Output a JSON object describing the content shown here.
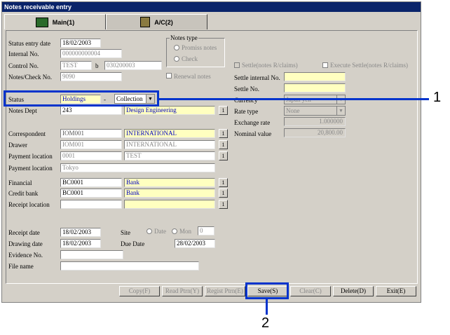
{
  "window": {
    "title": "Notes receivable entry"
  },
  "tabs": [
    {
      "label": "Main(1)"
    },
    {
      "label": "A/C(2)"
    }
  ],
  "form": {
    "status_entry_date": {
      "label": "Status entry date",
      "value": "18/02/2003"
    },
    "internal_no": {
      "label": "Internal No.",
      "value": "000000000004"
    },
    "control_no": {
      "label": "Control No.",
      "prefix": "TEST",
      "sep": "b",
      "value": "030200003"
    },
    "notes_check_no": {
      "label": "Notes/Check No.",
      "value": "9090"
    },
    "notes_type": {
      "label": "Notes type",
      "options": [
        "Promiss notes",
        "Check"
      ]
    },
    "renewal_notes": {
      "label": "Renewal notes"
    },
    "status": {
      "label": "Status",
      "value": "Holdings",
      "dash": "-",
      "select": "Collection"
    },
    "notes_dept": {
      "label": "Notes Dept",
      "code": "243",
      "name": "Design Engineering"
    },
    "correspondent": {
      "label": "Correspondent",
      "code": "IOM001",
      "name": "INTERNATIONAL"
    },
    "drawer": {
      "label": "Drawer",
      "code": "IOM001",
      "name": "INTERNATIONAL"
    },
    "payment_location": {
      "label": "Payment location",
      "code": "0001",
      "name": "TEST"
    },
    "payment_location2": {
      "label": "Payment location",
      "value": "Tokyo"
    },
    "financial": {
      "label": "Financial",
      "code": "BC0001",
      "name": "Bank"
    },
    "credit_bank": {
      "label": "Credit bank",
      "code": "BC0001",
      "name": "Bank"
    },
    "receipt_location": {
      "label": "Receipt location"
    },
    "receipt_date": {
      "label": "Receipt date",
      "value": "18/02/2003"
    },
    "site": {
      "label": "Site",
      "opt1": "Date",
      "opt2": "Mon",
      "value": "0"
    },
    "drawing_date": {
      "label": "Drawing date",
      "value": "18/02/2003"
    },
    "due_date": {
      "label": "Due Date",
      "value": "28/02/2003"
    },
    "evidence_no": {
      "label": "Evidence No."
    },
    "file_name": {
      "label": "File name"
    },
    "settle_chk": {
      "label": "Settle(notes R/claims)"
    },
    "exec_settle_chk": {
      "label": "Execute Settle(notes R/claims)"
    },
    "settle_internal_no": {
      "label": "Settle internal No."
    },
    "settle_no": {
      "label": "Settle No."
    },
    "currency": {
      "label": "Currency",
      "value": "Japan yen"
    },
    "rate_type": {
      "label": "Rate type",
      "value": "None"
    },
    "exchange_rate": {
      "label": "Exchange rate",
      "value": "1.000000"
    },
    "nominal_value": {
      "label": "Nominal value",
      "value": "20,800.00"
    },
    "btn_one": "1"
  },
  "buttons": {
    "copy": "Copy(F)",
    "read_ptrn": "Read Ptrn(Y)",
    "regist_ptrn": "Regist Ptrn(E)",
    "save": "Save(S)",
    "clear": "Clear(C)",
    "delete": "Delete(D)",
    "exit": "Exit(E)"
  },
  "callouts": [
    "1",
    "2"
  ],
  "colors": {
    "title_bg": "#0a246a",
    "highlight": "#0033cc",
    "required_bg": "#ffffc0"
  }
}
